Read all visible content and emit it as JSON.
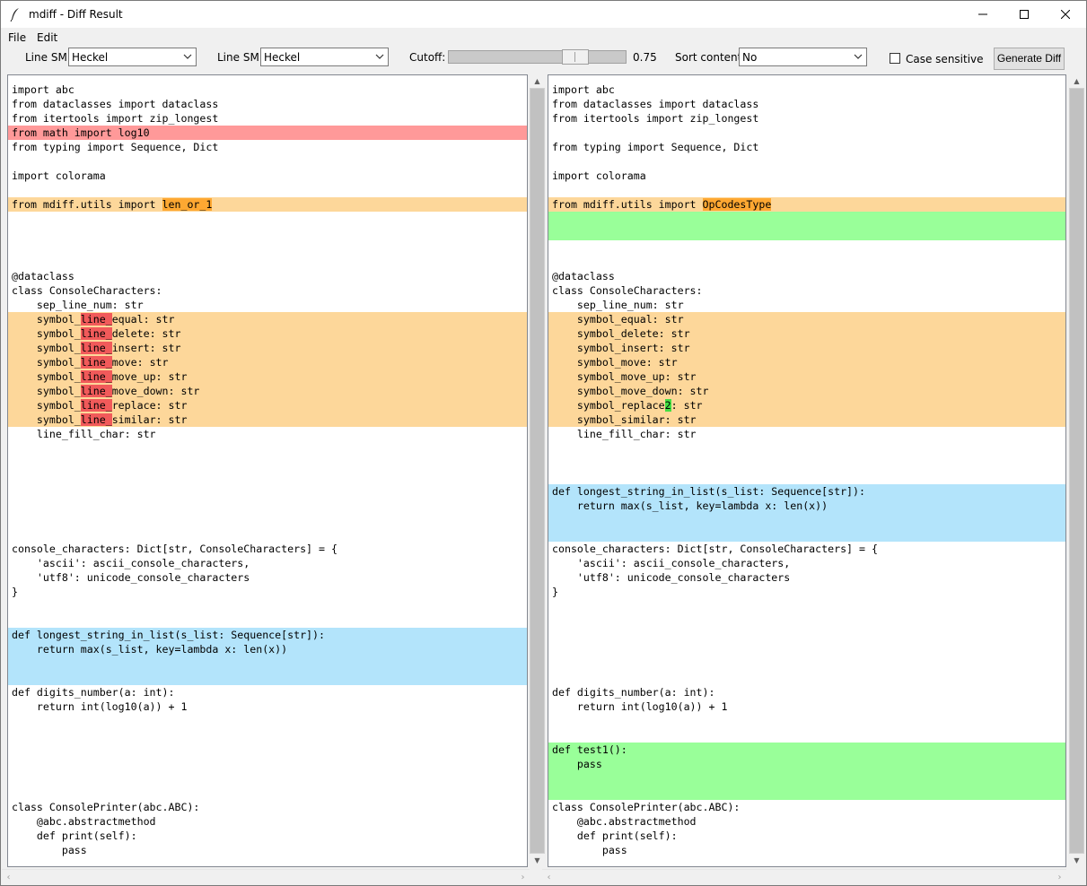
{
  "window": {
    "title": "mdiff - Diff Result",
    "icon": "feather-icon",
    "controls": [
      "minimize-icon",
      "maximize-icon",
      "close-icon"
    ]
  },
  "menu": {
    "file": "File",
    "edit": "Edit"
  },
  "toolbar": {
    "line_sm_label": "Line SM:",
    "line_sm_value": "Heckel",
    "line_sm2_label": "Line SM:",
    "line_sm2_value": "Heckel",
    "cutoff_label": "Cutoff:",
    "cutoff_value": "0.75",
    "cutoff_level": 0.75,
    "sort_label": "Sort content:",
    "sort_value": "No",
    "case_label": "Case sensitive",
    "case_checked": false,
    "generate_label": "Generate Diff"
  },
  "colors": {
    "deleted": "#ff9999",
    "changed": "#fdd79a",
    "inserted": "#99ff99",
    "moved": "#b3e4fb",
    "changed_token": "#fea832",
    "deleted_token": "#f15a5a",
    "inserted_token": "#42e042"
  },
  "left_lines": [
    {
      "t": "import abc",
      "k": ""
    },
    {
      "t": "from dataclasses import dataclass",
      "k": ""
    },
    {
      "t": "from itertools import zip_longest",
      "k": ""
    },
    {
      "t": "from math import log10",
      "k": "del"
    },
    {
      "t": "from typing import Sequence, Dict",
      "k": ""
    },
    {
      "t": "",
      "k": ""
    },
    {
      "t": "import colorama",
      "k": ""
    },
    {
      "t": "",
      "k": ""
    },
    {
      "t": "from mdiff.utils import len_or_1",
      "k": "chg",
      "hl": "len_or_1",
      "hk": "chg"
    },
    {
      "t": "",
      "k": ""
    },
    {
      "t": "",
      "k": ""
    },
    {
      "t": "",
      "k": ""
    },
    {
      "t": "",
      "k": ""
    },
    {
      "t": "@dataclass",
      "k": ""
    },
    {
      "t": "class ConsoleCharacters:",
      "k": ""
    },
    {
      "t": "    sep_line_num: str",
      "k": ""
    },
    {
      "t": "    symbol_line_equal: str",
      "k": "chg",
      "hl": "line_",
      "hk": "del"
    },
    {
      "t": "    symbol_line_delete: str",
      "k": "chg",
      "hl": "line_",
      "hk": "del"
    },
    {
      "t": "    symbol_line_insert: str",
      "k": "chg",
      "hl": "line_",
      "hk": "del"
    },
    {
      "t": "    symbol_line_move: str",
      "k": "chg",
      "hl": "line_",
      "hk": "del"
    },
    {
      "t": "    symbol_line_move_up: str",
      "k": "chg",
      "hl": "line_",
      "hk": "del"
    },
    {
      "t": "    symbol_line_move_down: str",
      "k": "chg",
      "hl": "line_",
      "hk": "del"
    },
    {
      "t": "    symbol_line_replace: str",
      "k": "chg",
      "hl": "line_",
      "hk": "del"
    },
    {
      "t": "    symbol_line_similar: str",
      "k": "chg",
      "hl": "line_",
      "hk": "del"
    },
    {
      "t": "    line_fill_char: str",
      "k": ""
    },
    {
      "t": "",
      "k": ""
    },
    {
      "t": "",
      "k": ""
    },
    {
      "t": "",
      "k": ""
    },
    {
      "t": "",
      "k": ""
    },
    {
      "t": "",
      "k": ""
    },
    {
      "t": "",
      "k": ""
    },
    {
      "t": "",
      "k": ""
    },
    {
      "t": "console_characters: Dict[str, ConsoleCharacters] = {",
      "k": ""
    },
    {
      "t": "    'ascii': ascii_console_characters,",
      "k": ""
    },
    {
      "t": "    'utf8': unicode_console_characters",
      "k": ""
    },
    {
      "t": "}",
      "k": ""
    },
    {
      "t": "",
      "k": ""
    },
    {
      "t": "",
      "k": ""
    },
    {
      "t": "def longest_string_in_list(s_list: Sequence[str]):",
      "k": "mov"
    },
    {
      "t": "    return max(s_list, key=lambda x: len(x))",
      "k": "mov"
    },
    {
      "t": "",
      "k": "mov"
    },
    {
      "t": "",
      "k": "mov"
    },
    {
      "t": "def digits_number(a: int):",
      "k": ""
    },
    {
      "t": "    return int(log10(a)) + 1",
      "k": ""
    },
    {
      "t": "",
      "k": ""
    },
    {
      "t": "",
      "k": ""
    },
    {
      "t": "",
      "k": ""
    },
    {
      "t": "",
      "k": ""
    },
    {
      "t": "",
      "k": ""
    },
    {
      "t": "",
      "k": ""
    },
    {
      "t": "class ConsolePrinter(abc.ABC):",
      "k": ""
    },
    {
      "t": "    @abc.abstractmethod",
      "k": ""
    },
    {
      "t": "    def print(self):",
      "k": ""
    },
    {
      "t": "        pass",
      "k": ""
    }
  ],
  "right_lines": [
    {
      "t": "import abc",
      "k": ""
    },
    {
      "t": "from dataclasses import dataclass",
      "k": ""
    },
    {
      "t": "from itertools import zip_longest",
      "k": ""
    },
    {
      "t": "",
      "k": ""
    },
    {
      "t": "from typing import Sequence, Dict",
      "k": ""
    },
    {
      "t": "",
      "k": ""
    },
    {
      "t": "import colorama",
      "k": ""
    },
    {
      "t": "",
      "k": ""
    },
    {
      "t": "from mdiff.utils import OpCodesType",
      "k": "chg",
      "hl": "OpCodesType",
      "hk": "chg"
    },
    {
      "t": "",
      "k": "add"
    },
    {
      "t": "",
      "k": "add"
    },
    {
      "t": "",
      "k": ""
    },
    {
      "t": "",
      "k": ""
    },
    {
      "t": "@dataclass",
      "k": ""
    },
    {
      "t": "class ConsoleCharacters:",
      "k": ""
    },
    {
      "t": "    sep_line_num: str",
      "k": ""
    },
    {
      "t": "    symbol_equal: str",
      "k": "chg"
    },
    {
      "t": "    symbol_delete: str",
      "k": "chg"
    },
    {
      "t": "    symbol_insert: str",
      "k": "chg"
    },
    {
      "t": "    symbol_move: str",
      "k": "chg"
    },
    {
      "t": "    symbol_move_up: str",
      "k": "chg"
    },
    {
      "t": "    symbol_move_down: str",
      "k": "chg"
    },
    {
      "t": "    symbol_replace2: str",
      "k": "chg",
      "hl": "2",
      "hk": "add"
    },
    {
      "t": "    symbol_similar: str",
      "k": "chg"
    },
    {
      "t": "    line_fill_char: str",
      "k": ""
    },
    {
      "t": "",
      "k": ""
    },
    {
      "t": "",
      "k": ""
    },
    {
      "t": "",
      "k": ""
    },
    {
      "t": "def longest_string_in_list(s_list: Sequence[str]):",
      "k": "mov"
    },
    {
      "t": "    return max(s_list, key=lambda x: len(x))",
      "k": "mov"
    },
    {
      "t": "",
      "k": "mov"
    },
    {
      "t": "",
      "k": "mov"
    },
    {
      "t": "console_characters: Dict[str, ConsoleCharacters] = {",
      "k": ""
    },
    {
      "t": "    'ascii': ascii_console_characters,",
      "k": ""
    },
    {
      "t": "    'utf8': unicode_console_characters",
      "k": ""
    },
    {
      "t": "}",
      "k": ""
    },
    {
      "t": "",
      "k": ""
    },
    {
      "t": "",
      "k": ""
    },
    {
      "t": "",
      "k": ""
    },
    {
      "t": "",
      "k": ""
    },
    {
      "t": "",
      "k": ""
    },
    {
      "t": "",
      "k": ""
    },
    {
      "t": "def digits_number(a: int):",
      "k": ""
    },
    {
      "t": "    return int(log10(a)) + 1",
      "k": ""
    },
    {
      "t": "",
      "k": ""
    },
    {
      "t": "",
      "k": ""
    },
    {
      "t": "def test1():",
      "k": "add"
    },
    {
      "t": "    pass",
      "k": "add"
    },
    {
      "t": "",
      "k": "add"
    },
    {
      "t": "",
      "k": "add"
    },
    {
      "t": "class ConsolePrinter(abc.ABC):",
      "k": ""
    },
    {
      "t": "    @abc.abstractmethod",
      "k": ""
    },
    {
      "t": "    def print(self):",
      "k": ""
    },
    {
      "t": "        pass",
      "k": ""
    }
  ]
}
